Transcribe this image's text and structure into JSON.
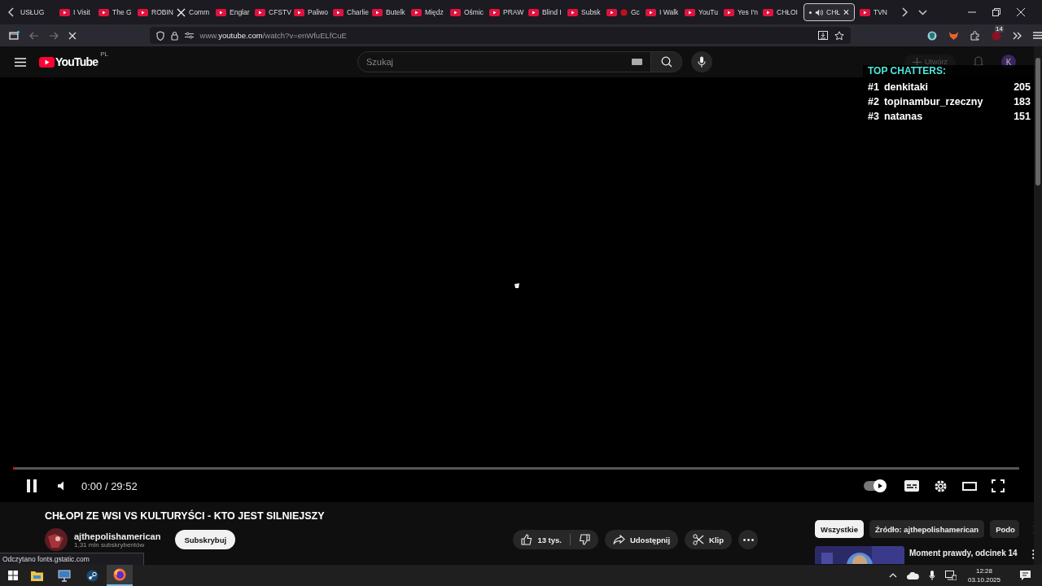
{
  "browser": {
    "tabs": [
      {
        "title": "USŁUG",
        "kind": "none",
        "selected": false,
        "playing": false
      },
      {
        "title": "I Visit",
        "kind": "youtube",
        "selected": false,
        "playing": false
      },
      {
        "title": "The G",
        "kind": "youtube",
        "selected": false,
        "playing": false
      },
      {
        "title": "ROBIN",
        "kind": "youtube",
        "selected": false,
        "playing": false
      },
      {
        "title": "Comm",
        "kind": "x",
        "selected": false,
        "playing": false
      },
      {
        "title": "Englar",
        "kind": "youtube",
        "selected": false,
        "playing": false
      },
      {
        "title": "CFSTV",
        "kind": "youtube",
        "selected": false,
        "playing": false
      },
      {
        "title": "Paliwo",
        "kind": "youtube",
        "selected": false,
        "playing": false
      },
      {
        "title": "Charlie",
        "kind": "youtube",
        "selected": false,
        "playing": false
      },
      {
        "title": "Butelk",
        "kind": "youtube",
        "selected": false,
        "playing": false
      },
      {
        "title": "Międz",
        "kind": "youtube",
        "selected": false,
        "playing": false
      },
      {
        "title": "Ośmic",
        "kind": "youtube",
        "selected": false,
        "playing": false
      },
      {
        "title": "PRAW",
        "kind": "youtube",
        "selected": false,
        "playing": false
      },
      {
        "title": "Blind I",
        "kind": "youtube",
        "selected": false,
        "playing": false
      },
      {
        "title": "Subsk",
        "kind": "youtube",
        "selected": false,
        "playing": false
      },
      {
        "title": "Gc",
        "kind": "recording",
        "selected": false,
        "playing": false
      },
      {
        "title": "I Walk",
        "kind": "youtube",
        "selected": false,
        "playing": false
      },
      {
        "title": "YouTu",
        "kind": "youtube",
        "selected": false,
        "playing": false
      },
      {
        "title": "Yes I'n",
        "kind": "youtube",
        "selected": false,
        "playing": false
      },
      {
        "title": "CHŁOI",
        "kind": "youtube",
        "selected": false,
        "playing": false
      },
      {
        "title": "CHŁ",
        "kind": "none",
        "selected": true,
        "playing": true
      },
      {
        "title": "TVN",
        "kind": "youtube",
        "selected": false,
        "playing": false
      }
    ],
    "address": "www.**youtube.com**/watch?v=enWfuELfCuE",
    "extension_badge": "14"
  },
  "youtube": {
    "logo": "YouTube",
    "region": "PL",
    "search": {
      "placeholder": "Szukaj"
    },
    "create": "Utwórz",
    "avatar": "K"
  },
  "chat_overlay": {
    "title": "TOP CHATTERS:",
    "chatters": [
      {
        "rank": "#1",
        "name": "denkitaki",
        "count": "205"
      },
      {
        "rank": "#2",
        "name": "topinambur_rzeczny",
        "count": "183"
      },
      {
        "rank": "#3",
        "name": "natanas",
        "count": "151"
      }
    ]
  },
  "player": {
    "playing": true,
    "progress": {
      "level": 0
    },
    "time": "0:00 / 29:52",
    "autoplay": true
  },
  "video": {
    "title": "CHŁOPI ZE WSI VS KULTURYŚCI - KTO JEST SILNIEJSZY",
    "channel": "ajthepolishamerican",
    "subscribers": "1,31 mln subskrybentów",
    "subscribe": "Subskrybuj",
    "likes": "13 tys.",
    "share": "Udostępnij",
    "clip": "Klip"
  },
  "chips": [
    {
      "label": "Wszystkie",
      "selected": true
    },
    {
      "label": "Źródło: ajthepolishamerican",
      "selected": false
    },
    {
      "label": "Podo",
      "selected": false
    }
  ],
  "recommended": [
    {
      "title": "Moment prawdy, odcinek 14"
    }
  ],
  "status": "Odczytano fonts.gstatic.com",
  "taskbar": {
    "apps": [
      {
        "kind": "files",
        "selected": false
      },
      {
        "kind": "remote",
        "selected": false
      },
      {
        "kind": "steam",
        "selected": false
      },
      {
        "kind": "firefox",
        "selected": true
      }
    ],
    "time": "12:28",
    "date": "03.10.2025"
  }
}
